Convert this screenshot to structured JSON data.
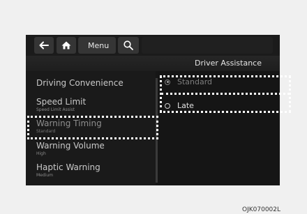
{
  "toolbar": {
    "back_icon": "arrow-left-icon",
    "home_icon": "home-icon",
    "menu_label": "Menu",
    "search_icon": "search-icon"
  },
  "header": {
    "title": "Driver Assistance"
  },
  "menu": {
    "items": [
      {
        "label": "Driving Convenience",
        "sub": ""
      },
      {
        "label": "Speed Limit",
        "sub": "Speed Limit Assist"
      },
      {
        "label": "Warning Timing",
        "sub": "Standard"
      },
      {
        "label": "Warning Volume",
        "sub": "High"
      },
      {
        "label": "Haptic Warning",
        "sub": "Medium"
      }
    ]
  },
  "options": {
    "items": [
      {
        "label": "Standard",
        "selected": true
      },
      {
        "label": "Late",
        "selected": false
      }
    ]
  },
  "figure_code": "OJK070002L",
  "colors": {
    "screen_bg": "#161616",
    "highlight": "#ffffff"
  }
}
